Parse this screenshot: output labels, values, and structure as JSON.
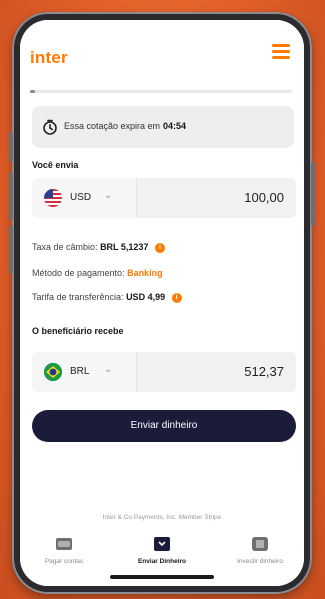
{
  "app": {
    "logo": "inter",
    "menu_icon": "hamburger-menu-icon",
    "accent_color": "#ff7a00",
    "dark_button_color": "#1b1b3a"
  },
  "quote_timer": {
    "icon": "clock-icon",
    "text": "Essa cotação expira em",
    "time": "04:54",
    "progress": 0.02
  },
  "send": {
    "label": "Você envia",
    "currency_code": "USD",
    "flag_icon": "us-flag-icon",
    "amount": "100,00"
  },
  "details": {
    "exchange_rate_label": "Taxa de câmbio:",
    "exchange_rate_value": "BRL 5,1237",
    "payment_method_label": "Método de pagamento:",
    "payment_method_value": "Banking",
    "transfer_fee_label": "Tarifa de transferência:",
    "transfer_fee_value": "USD 4,99",
    "info_icon": "info-icon"
  },
  "receive": {
    "label": "O beneficiário recebe",
    "currency_code": "BRL",
    "flag_icon": "br-flag-icon",
    "amount": "512,37"
  },
  "actions": {
    "send_money": "Enviar dinheiro"
  },
  "footer": {
    "note": "Inter & Co Payments, Inc. Member Stripe"
  },
  "bottom_nav": [
    {
      "icon": "card-icon",
      "label": "Pagar contas",
      "active": false
    },
    {
      "icon": "send-money-icon",
      "label": "Enviar Dinheiro",
      "active": true
    },
    {
      "icon": "invest-icon",
      "label": "Investir dinheiro",
      "active": false
    }
  ]
}
